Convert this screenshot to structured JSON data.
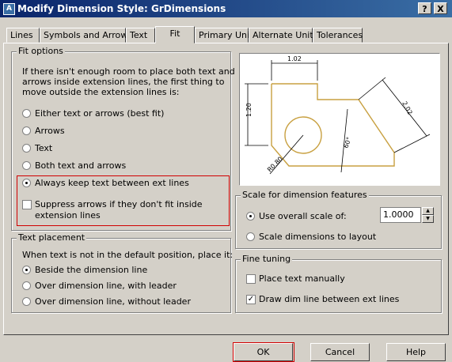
{
  "window": {
    "title": "Modify Dimension Style: GrDimensions",
    "help_btn": "?",
    "close_btn": "X"
  },
  "tabs": [
    "Lines",
    "Symbols and Arrows",
    "Text",
    "Fit",
    "Primary Units",
    "Alternate Units",
    "Tolerances"
  ],
  "active_tab": "Fit",
  "fit_options": {
    "title": "Fit options",
    "description": [
      "If there isn't enough room to place both text and",
      "arrows inside extension lines, the first thing to",
      "move outside the extension lines is:"
    ],
    "options": [
      "Either text or arrows (best fit)",
      "Arrows",
      "Text",
      "Both text and arrows",
      "Always keep text between ext lines"
    ],
    "selected": "Always keep text between ext lines",
    "suppress_label_line1": "Suppress arrows if they don't fit inside",
    "suppress_label_line2": "extension lines",
    "suppress_checked": false
  },
  "preview": {
    "labels": [
      "1.02",
      "1.20",
      "2.02",
      "R0.80",
      "60°"
    ]
  },
  "scale": {
    "title": "Scale for dimension features",
    "use_overall": "Use overall scale of:",
    "value": "1.0000",
    "scale_to_layout": "Scale dimensions to layout",
    "selected": "Use overall scale of:"
  },
  "text_placement": {
    "title": "Text placement",
    "description": "When text is not in the default position, place it:",
    "options": [
      "Beside the dimension line",
      "Over dimension line, with leader",
      "Over dimension line, without leader"
    ],
    "selected": "Beside the dimension line"
  },
  "fine_tuning": {
    "title": "Fine tuning",
    "place_manually": "Place text manually",
    "place_manually_checked": false,
    "draw_dim_line": "Draw dim line between ext lines",
    "draw_dim_line_checked": true
  },
  "buttons": {
    "ok": "OK",
    "cancel": "Cancel",
    "help": "Help"
  },
  "colors": {
    "title_bar_start": "#0a246a",
    "title_bar_end": "#3a6ea5",
    "dialog_bg": "#d4d0c8",
    "highlight": "#d00000",
    "preview_shape": "#c8a040"
  }
}
